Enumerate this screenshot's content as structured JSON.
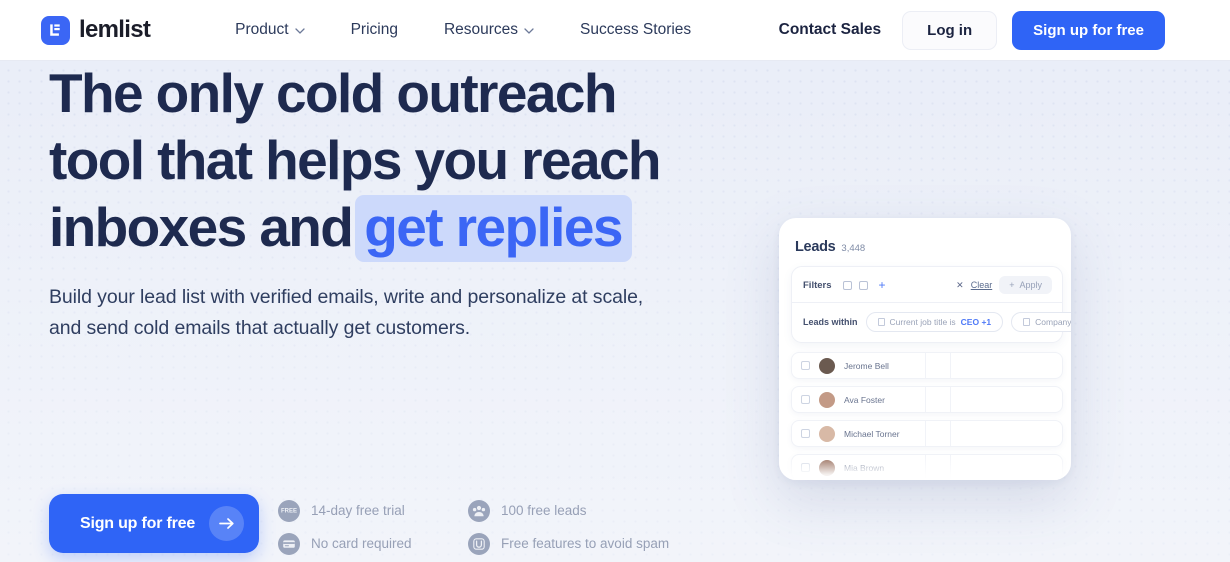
{
  "header": {
    "brand": {
      "name": "lemlist",
      "logo_icon": "lemlist-logo-icon"
    },
    "nav": [
      {
        "label": "Product",
        "has_chevron": true
      },
      {
        "label": "Pricing",
        "has_chevron": false
      },
      {
        "label": "Resources",
        "has_chevron": true
      },
      {
        "label": "Success Stories",
        "has_chevron": false
      }
    ],
    "contact_sales": "Contact Sales",
    "login": "Log in",
    "signup": "Sign up for free"
  },
  "hero": {
    "headline_line1": "The only cold outreach",
    "headline_line2": "tool that helps you reach",
    "headline_line3_prefix": "inboxes and",
    "headline_highlight": "get replies",
    "subhead": "Build your lead list with verified emails, write and personalize at scale, and send cold emails that actually get customers.",
    "cta": {
      "label": "Sign up for free",
      "icon": "arrow-right-icon"
    },
    "features": [
      {
        "label": "14-day free trial",
        "icon": "free-badge-icon",
        "glyph": "FREE"
      },
      {
        "label": "100 free leads",
        "icon": "leads-group-icon",
        "glyph": "···"
      },
      {
        "label": "No card required",
        "icon": "credit-card-icon",
        "glyph": ""
      },
      {
        "label": "Free features to avoid spam",
        "icon": "unsubscribe-icon",
        "glyph": "U"
      }
    ]
  },
  "mockup": {
    "title": "Leads",
    "count": "3,448",
    "filters": {
      "label": "Filters",
      "clear": "Clear",
      "apply": "Apply",
      "plus": "+",
      "close": "✕"
    },
    "within": {
      "label_strong": "Leads",
      "label_rest": "within",
      "chips": [
        {
          "text_prefix": "Current job title is ",
          "text_value": "CEO +1"
        },
        {
          "text_prefix": "Company name",
          "text_value": ""
        }
      ]
    },
    "rows": [
      {
        "name": "Jerome Bell",
        "avatar_color": "#6b5a50"
      },
      {
        "name": "Ava Foster",
        "avatar_color": "#c39a86"
      },
      {
        "name": "Michael Torner",
        "avatar_color": "#d8b9a6"
      },
      {
        "name": "Mia Brown",
        "avatar_color": "#8a5a45"
      }
    ]
  },
  "colors": {
    "brand_blue": "#2f64f6",
    "headline_navy": "#1e2a4f",
    "highlight_bg": "#ccd9fb",
    "hero_bg": "#e9edf7"
  }
}
